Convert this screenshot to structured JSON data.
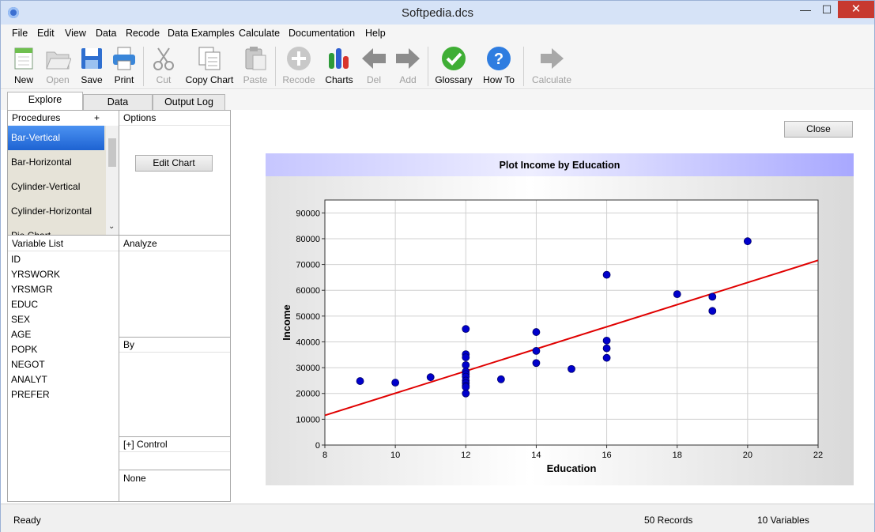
{
  "window": {
    "title": "Softpedia.dcs",
    "minimize": "—",
    "maximize": "☐",
    "close": "✕"
  },
  "menu": [
    "File",
    "Edit",
    "View",
    "Data",
    "Recode",
    "Data Examples",
    "Calculate",
    "Documentation",
    "Help"
  ],
  "toolbar": [
    {
      "label": "New",
      "icon": "new-icon",
      "enabled": true
    },
    {
      "label": "Open",
      "icon": "open-icon",
      "enabled": false
    },
    {
      "label": "Save",
      "icon": "save-icon",
      "enabled": true
    },
    {
      "label": "Print",
      "icon": "print-icon",
      "enabled": true
    },
    {
      "label": "Cut",
      "icon": "cut-icon",
      "enabled": false
    },
    {
      "label": "Copy Chart",
      "icon": "copy-icon",
      "enabled": true
    },
    {
      "label": "Paste",
      "icon": "paste-icon",
      "enabled": false
    },
    {
      "label": "Recode",
      "icon": "recode-icon",
      "enabled": false
    },
    {
      "label": "Charts",
      "icon": "charts-icon",
      "enabled": true
    },
    {
      "label": "Del",
      "icon": "arrow-left-icon",
      "enabled": false
    },
    {
      "label": "Add",
      "icon": "arrow-right-icon",
      "enabled": false
    },
    {
      "label": "Glossary",
      "icon": "glossary-check-icon",
      "enabled": true
    },
    {
      "label": "How To",
      "icon": "help-icon",
      "enabled": true
    },
    {
      "label": "Calculate",
      "icon": "calculate-arrow-icon",
      "enabled": false
    }
  ],
  "tabs": [
    "Explore",
    "Data",
    "Output Log"
  ],
  "procedures": {
    "header": "Procedures",
    "add": "+",
    "items": [
      "Bar-Vertical",
      "Bar-Horizontal",
      "Cylinder-Vertical",
      "Cylinder-Horizontal",
      "Pie Chart"
    ],
    "selected": "Bar-Vertical"
  },
  "options": {
    "header": "Options",
    "edit_chart": "Edit Chart"
  },
  "variables": {
    "header": "Variable List",
    "items": [
      "ID",
      "YRSWORK",
      "YRSMGR",
      "EDUC",
      "SEX",
      "AGE",
      "POPK",
      "NEGOT",
      "ANALYT",
      "PREFER"
    ]
  },
  "analyze": {
    "header": "Analyze"
  },
  "by": {
    "header": "By"
  },
  "control": {
    "header": "[+] Control",
    "value": "None"
  },
  "close_button": "Close",
  "status": {
    "ready": "Ready",
    "records": "50 Records",
    "variables": "10 Variables"
  },
  "colors": {
    "point": "#0000cc",
    "fit_line": "#e00000",
    "selection": "#2f78e0"
  },
  "chart_data": {
    "type": "scatter",
    "title": "Plot Income by Education",
    "xlabel": "Education",
    "ylabel": "Income",
    "xlim": [
      8,
      22
    ],
    "ylim": [
      0,
      95000
    ],
    "xticks": [
      "8",
      "10",
      "12",
      "14",
      "16",
      "18",
      "20",
      "22"
    ],
    "yticks": [
      "0",
      "10000",
      "20000",
      "30000",
      "40000",
      "50000",
      "60000",
      "70000",
      "80000",
      "90000"
    ],
    "grid": true,
    "points": [
      [
        9,
        24800
      ],
      [
        10,
        24200
      ],
      [
        11,
        26300
      ],
      [
        12,
        45000
      ],
      [
        12,
        35200
      ],
      [
        12,
        34000
      ],
      [
        12,
        31000
      ],
      [
        12,
        28500
      ],
      [
        12,
        27500
      ],
      [
        12,
        26500
      ],
      [
        12,
        25000
      ],
      [
        12,
        24000
      ],
      [
        12,
        23000
      ],
      [
        12,
        22500
      ],
      [
        12,
        20000
      ],
      [
        13,
        25500
      ],
      [
        14,
        43800
      ],
      [
        14,
        36500
      ],
      [
        14,
        31800
      ],
      [
        15,
        29500
      ],
      [
        16,
        66000
      ],
      [
        16,
        40500
      ],
      [
        16,
        37500
      ],
      [
        16,
        33800
      ],
      [
        18,
        58500
      ],
      [
        19,
        57500
      ],
      [
        19,
        52000
      ],
      [
        20,
        79000
      ]
    ],
    "fit_line": [
      [
        8,
        11500
      ],
      [
        22,
        71600
      ]
    ]
  }
}
